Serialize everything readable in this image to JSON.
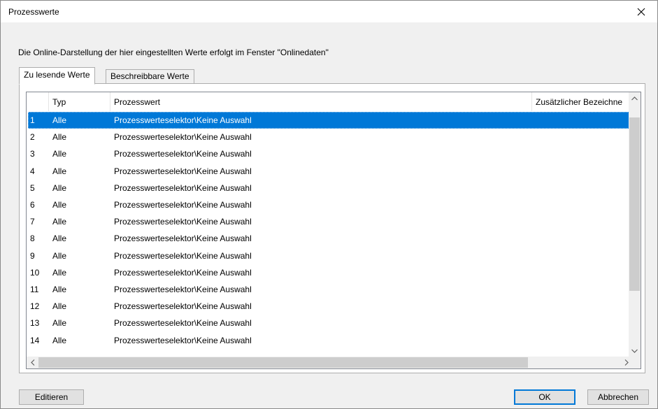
{
  "window": {
    "title": "Prozesswerte"
  },
  "info_text": "Die Online-Darstellung der hier eingestellten Werte erfolgt im Fenster \"Onlinedaten\"",
  "tabs": [
    {
      "label": "Zu lesende Werte",
      "active": true
    },
    {
      "label": "Beschreibbare Werte",
      "active": false
    }
  ],
  "grid": {
    "columns": [
      "",
      "Typ",
      "Prozesswert",
      "Zusätzlicher Bezeichne"
    ],
    "selected_row": 1,
    "rows": [
      {
        "nr": "1",
        "typ": "Alle",
        "wert": "Prozesswerteselektor\\Keine Auswahl",
        "extra": ""
      },
      {
        "nr": "2",
        "typ": "Alle",
        "wert": "Prozesswerteselektor\\Keine Auswahl",
        "extra": ""
      },
      {
        "nr": "3",
        "typ": "Alle",
        "wert": "Prozesswerteselektor\\Keine Auswahl",
        "extra": ""
      },
      {
        "nr": "4",
        "typ": "Alle",
        "wert": "Prozesswerteselektor\\Keine Auswahl",
        "extra": ""
      },
      {
        "nr": "5",
        "typ": "Alle",
        "wert": "Prozesswerteselektor\\Keine Auswahl",
        "extra": ""
      },
      {
        "nr": "6",
        "typ": "Alle",
        "wert": "Prozesswerteselektor\\Keine Auswahl",
        "extra": ""
      },
      {
        "nr": "7",
        "typ": "Alle",
        "wert": "Prozesswerteselektor\\Keine Auswahl",
        "extra": ""
      },
      {
        "nr": "8",
        "typ": "Alle",
        "wert": "Prozesswerteselektor\\Keine Auswahl",
        "extra": ""
      },
      {
        "nr": "9",
        "typ": "Alle",
        "wert": "Prozesswerteselektor\\Keine Auswahl",
        "extra": ""
      },
      {
        "nr": "10",
        "typ": "Alle",
        "wert": "Prozesswerteselektor\\Keine Auswahl",
        "extra": ""
      },
      {
        "nr": "11",
        "typ": "Alle",
        "wert": "Prozesswerteselektor\\Keine Auswahl",
        "extra": ""
      },
      {
        "nr": "12",
        "typ": "Alle",
        "wert": "Prozesswerteselektor\\Keine Auswahl",
        "extra": ""
      },
      {
        "nr": "13",
        "typ": "Alle",
        "wert": "Prozesswerteselektor\\Keine Auswahl",
        "extra": ""
      },
      {
        "nr": "14",
        "typ": "Alle",
        "wert": "Prozesswerteselektor\\Keine Auswahl",
        "extra": ""
      }
    ]
  },
  "buttons": {
    "edit": "Editieren",
    "ok": "OK",
    "cancel": "Abbrechen"
  },
  "colors": {
    "selection": "#0078d7",
    "dialog_bg": "#f0f0f0"
  }
}
